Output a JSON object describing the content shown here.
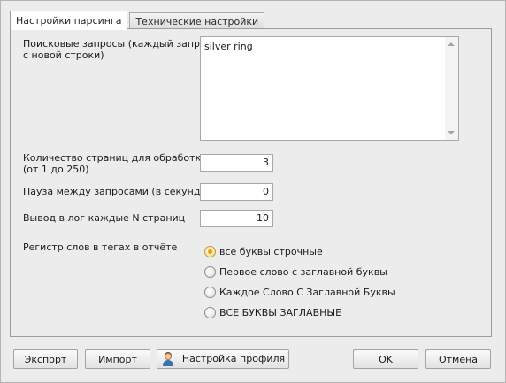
{
  "tabs": [
    {
      "label": "Настройки парсинга",
      "active": true
    },
    {
      "label": "Технические настройки",
      "active": false
    }
  ],
  "form": {
    "queries_label": "Поисковые запросы (каждый запрос с новой строки)",
    "queries_label_line1": "Поисковые запросы (каждый запрос",
    "queries_label_line2": "с новой строки)",
    "queries_value": "silver ring",
    "pages_label_line1": "Количество страниц для обработки",
    "pages_label_line2": "(от 1 до 250)",
    "pages_value": "3",
    "pause_label": "Пауза между запросами (в секундах)",
    "pause_value": "0",
    "log_label": "Вывод в лог каждые N страниц",
    "log_value": "10",
    "case_label": "Регистр слов в тегах в отчёте",
    "case_options": [
      {
        "label": "все буквы строчные",
        "checked": true
      },
      {
        "label": "Первое слово с заглавной буквы",
        "checked": false
      },
      {
        "label": "Каждое Слово С Заглавной Буквы",
        "checked": false
      },
      {
        "label": "ВСЕ БУКВЫ ЗАГЛАВНЫЕ",
        "checked": false
      }
    ]
  },
  "buttons": {
    "export": "Экспорт",
    "import": "Импорт",
    "profile": "Настройка профиля",
    "ok": "OK",
    "cancel": "Отмена"
  },
  "colors": {
    "background": "#ececec",
    "radio_selected": "#e0a014"
  },
  "icons": {
    "profile_button_icon": "user-icon"
  }
}
